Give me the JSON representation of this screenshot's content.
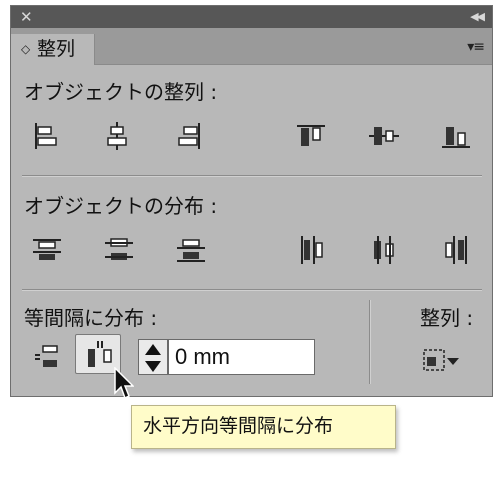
{
  "window": {
    "close_icon": "close-icon",
    "collapse_icon": "collapse-icon"
  },
  "tab": {
    "label": "整列",
    "arrows": "◇"
  },
  "sections": {
    "align_objects": {
      "title": "オブジェクトの整列 :"
    },
    "distribute_objects": {
      "title": "オブジェクトの分布 :"
    },
    "distribute_spacing": {
      "title": "等間隔に分布 :"
    },
    "align_to": {
      "title": "整列 :"
    }
  },
  "spacing": {
    "value": "0 mm"
  },
  "tooltip": {
    "text": "水平方向等間隔に分布"
  },
  "icons": {
    "align_objects": [
      "align-left-icon",
      "align-horizontal-center-icon",
      "align-right-icon",
      "align-top-icon",
      "align-vertical-center-icon",
      "align-bottom-icon"
    ],
    "distribute_objects": [
      "distribute-top-icon",
      "distribute-vertical-center-icon",
      "distribute-bottom-icon",
      "distribute-left-icon",
      "distribute-horizontal-center-icon",
      "distribute-right-icon"
    ],
    "distribute_spacing": [
      "vertical-distribute-space-icon",
      "horizontal-distribute-space-icon"
    ],
    "align_to": "align-to-selection-icon"
  },
  "colors": {
    "panel_bg": "#b8b8b8",
    "titlebar": "#575757",
    "tooltip_bg": "#fffcc9"
  }
}
